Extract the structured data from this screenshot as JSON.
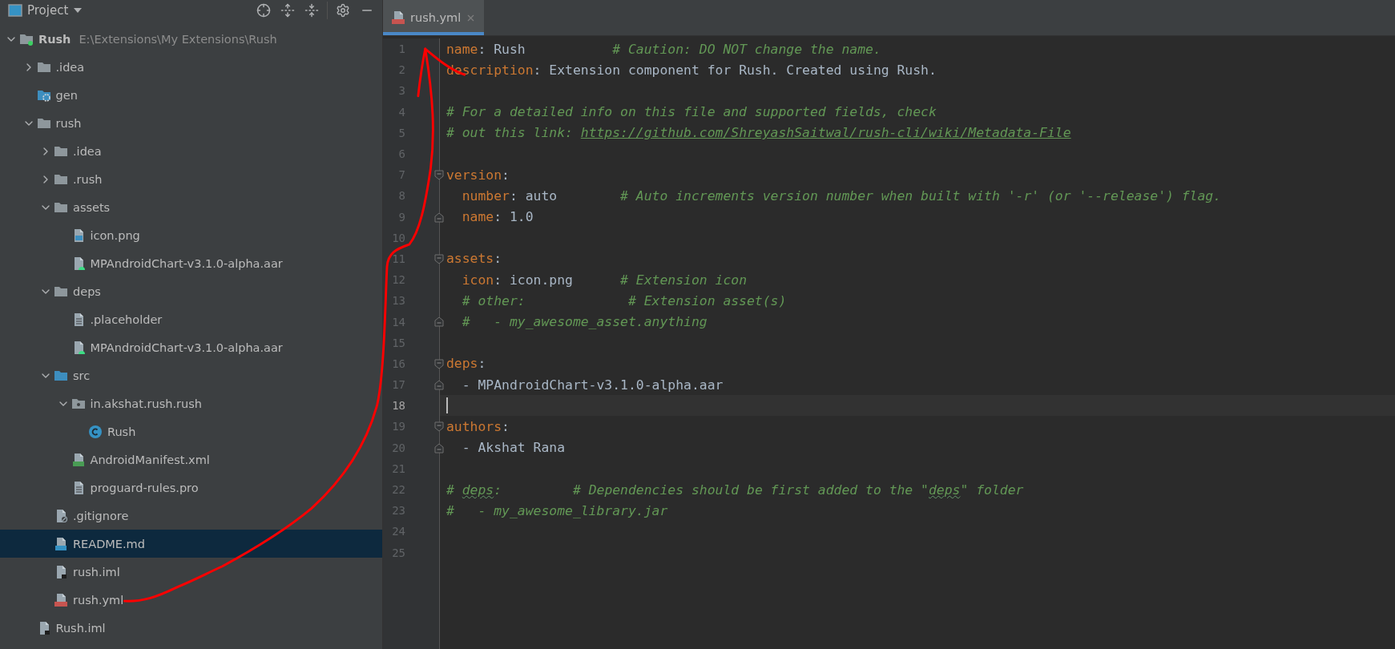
{
  "project_panel": {
    "title": "Project",
    "tree": [
      {
        "name": "Rush",
        "path": "E:\\Extensions\\My Extensions\\Rush",
        "kind": "module",
        "expanded": true,
        "selected": false,
        "children": [
          {
            "name": ".idea",
            "kind": "folder",
            "expanded": false,
            "selected": false
          },
          {
            "name": "gen",
            "kind": "generated",
            "selected": false
          },
          {
            "name": "rush",
            "kind": "folder",
            "expanded": true,
            "selected": false,
            "children": [
              {
                "name": ".idea",
                "kind": "folder",
                "expanded": false,
                "selected": false
              },
              {
                "name": ".rush",
                "kind": "folder",
                "expanded": false,
                "selected": false
              },
              {
                "name": "assets",
                "kind": "folder",
                "expanded": true,
                "selected": false,
                "children": [
                  {
                    "name": "icon.png",
                    "kind": "image",
                    "selected": false
                  },
                  {
                    "name": "MPAndroidChart-v3.1.0-alpha.aar",
                    "kind": "aar",
                    "selected": false
                  }
                ]
              },
              {
                "name": "deps",
                "kind": "folder",
                "expanded": true,
                "selected": false,
                "children": [
                  {
                    "name": ".placeholder",
                    "kind": "text",
                    "selected": false
                  },
                  {
                    "name": "MPAndroidChart-v3.1.0-alpha.aar",
                    "kind": "aar",
                    "selected": false
                  }
                ]
              },
              {
                "name": "src",
                "kind": "source",
                "expanded": true,
                "selected": false,
                "children": [
                  {
                    "name": "in.akshat.rush.rush",
                    "kind": "package",
                    "expanded": true,
                    "selected": false,
                    "children": [
                      {
                        "name": "Rush",
                        "kind": "class",
                        "selected": false
                      }
                    ]
                  },
                  {
                    "name": "AndroidManifest.xml",
                    "kind": "manifest",
                    "selected": false
                  },
                  {
                    "name": "proguard-rules.pro",
                    "kind": "text",
                    "selected": false
                  }
                ]
              },
              {
                "name": ".gitignore",
                "kind": "ignore",
                "selected": false
              },
              {
                "name": "README.md",
                "kind": "markdown",
                "selected": true
              },
              {
                "name": "rush.iml",
                "kind": "iml",
                "selected": false
              },
              {
                "name": "rush.yml",
                "kind": "yml",
                "selected": false
              }
            ]
          },
          {
            "name": "Rush.iml",
            "kind": "iml",
            "selected": false
          }
        ]
      }
    ]
  },
  "editor": {
    "tabs": [
      {
        "label": "rush.yml",
        "kind": "yml",
        "selected": true
      }
    ],
    "lines": [
      {
        "number": "1",
        "kind": "plain",
        "tokens": [
          {
            "kind": "key",
            "text": "name"
          },
          {
            "kind": "plain",
            "text": ": Rush           "
          },
          {
            "kind": "comment",
            "text": "# Caution: DO NOT change the name."
          }
        ]
      },
      {
        "number": "2",
        "kind": "plain",
        "tokens": [
          {
            "kind": "key",
            "text": "description"
          },
          {
            "kind": "plain",
            "text": ": Extension component for Rush. Created using Rush."
          }
        ]
      },
      {
        "number": "3",
        "kind": "plain"
      },
      {
        "number": "4",
        "kind": "plain",
        "tokens": [
          {
            "kind": "comment",
            "text": "# For a detailed info on this file and supported fields, check"
          }
        ]
      },
      {
        "number": "5",
        "kind": "plain",
        "tokens": [
          {
            "kind": "comment",
            "text": "# out this link: "
          },
          {
            "kind": "link",
            "text": "https://github.com/ShreyashSaitwal/rush-cli/wiki/Metadata-File"
          }
        ]
      },
      {
        "number": "6",
        "kind": "plain"
      },
      {
        "number": "7",
        "kind": "open",
        "tokens": [
          {
            "kind": "key",
            "text": "version"
          },
          {
            "kind": "plain",
            "text": ":"
          }
        ]
      },
      {
        "number": "8",
        "kind": "plain",
        "tokens": [
          {
            "kind": "key",
            "text": "  number"
          },
          {
            "kind": "plain",
            "text": ": auto        "
          },
          {
            "kind": "comment",
            "text": "# Auto increments version number when built with '-r' (or '--release') flag."
          }
        ]
      },
      {
        "number": "9",
        "kind": "close",
        "tokens": [
          {
            "kind": "key",
            "text": "  name"
          },
          {
            "kind": "plain",
            "text": ": 1.0"
          }
        ]
      },
      {
        "number": "10",
        "kind": "plain"
      },
      {
        "number": "11",
        "kind": "open",
        "tokens": [
          {
            "kind": "key",
            "text": "assets"
          },
          {
            "kind": "plain",
            "text": ":"
          }
        ]
      },
      {
        "number": "12",
        "kind": "plain",
        "tokens": [
          {
            "kind": "key",
            "text": "  icon"
          },
          {
            "kind": "plain",
            "text": ": icon.png      "
          },
          {
            "kind": "comment",
            "text": "# Extension icon"
          }
        ]
      },
      {
        "number": "13",
        "kind": "plain",
        "tokens": [
          {
            "kind": "comment",
            "text": "  # other:             # Extension asset(s)"
          }
        ]
      },
      {
        "number": "14",
        "kind": "close",
        "tokens": [
          {
            "kind": "comment",
            "text": "  #   - my_awesome_asset.anything"
          }
        ]
      },
      {
        "number": "15",
        "kind": "plain"
      },
      {
        "number": "16",
        "kind": "open",
        "tokens": [
          {
            "kind": "key",
            "text": "deps"
          },
          {
            "kind": "plain",
            "text": ":"
          }
        ]
      },
      {
        "number": "17",
        "kind": "close",
        "tokens": [
          {
            "kind": "plain",
            "text": "  - MPAndroidChart-v3.1.0-alpha.aar"
          }
        ]
      },
      {
        "number": "18",
        "kind": "plain",
        "current": true
      },
      {
        "number": "19",
        "kind": "open",
        "tokens": [
          {
            "kind": "key",
            "text": "authors"
          },
          {
            "kind": "plain",
            "text": ":"
          }
        ]
      },
      {
        "number": "20",
        "kind": "close",
        "tokens": [
          {
            "kind": "plain",
            "text": "  - Akshat Rana"
          }
        ]
      },
      {
        "number": "21",
        "kind": "plain"
      },
      {
        "number": "22",
        "kind": "plain",
        "tokens": [
          {
            "kind": "comment",
            "text": "# "
          },
          {
            "kind": "typo",
            "text": "deps"
          },
          {
            "kind": "comment",
            "text": ":         # Dependencies should be first added to the \""
          },
          {
            "kind": "typo",
            "text": "deps"
          },
          {
            "kind": "comment",
            "text": "\" folder"
          }
        ]
      },
      {
        "number": "23",
        "kind": "plain",
        "tokens": [
          {
            "kind": "comment",
            "text": "#   - my_awesome_library.jar"
          }
        ]
      },
      {
        "number": "24",
        "kind": "plain"
      },
      {
        "number": "25",
        "kind": "plain"
      }
    ]
  }
}
